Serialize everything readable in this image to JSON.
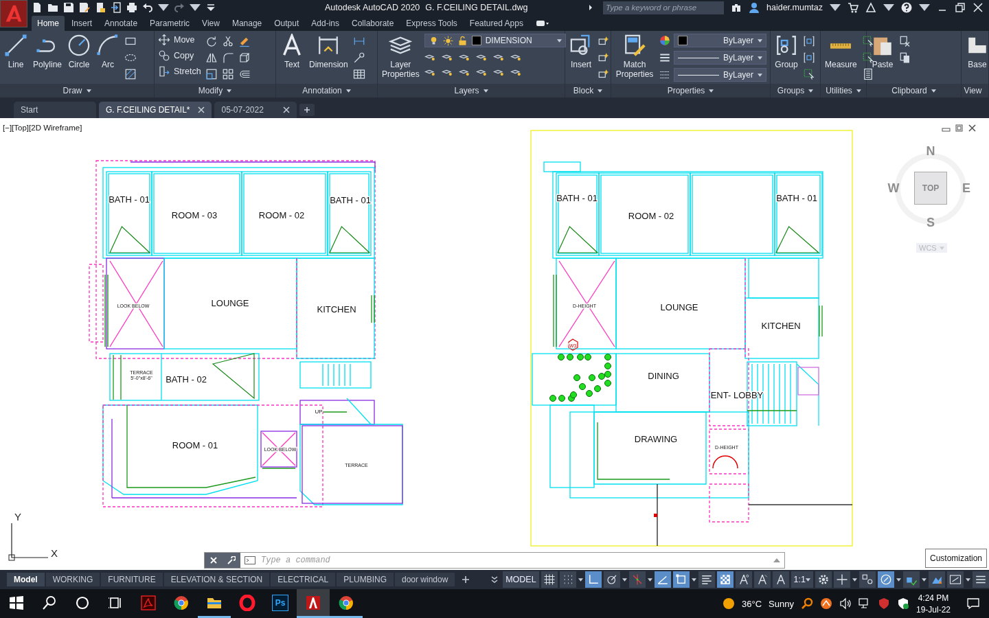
{
  "app": {
    "title": "Autodesk AutoCAD 2020",
    "file": "G. F.CEILING DETAIL.dwg",
    "search_placeholder": "Type a keyword or phrase",
    "user": "haider.mumtaz"
  },
  "ribbon_tabs": [
    {
      "label": "Home",
      "selected": true
    },
    {
      "label": "Insert",
      "selected": false
    },
    {
      "label": "Annotate",
      "selected": false
    },
    {
      "label": "Parametric",
      "selected": false
    },
    {
      "label": "View",
      "selected": false
    },
    {
      "label": "Manage",
      "selected": false
    },
    {
      "label": "Output",
      "selected": false
    },
    {
      "label": "Add-ins",
      "selected": false
    },
    {
      "label": "Collaborate",
      "selected": false
    },
    {
      "label": "Express Tools",
      "selected": false
    },
    {
      "label": "Featured Apps",
      "selected": false
    }
  ],
  "panels": [
    {
      "title": "Draw",
      "tools": [
        "Line",
        "Polyline",
        "Circle",
        "Arc"
      ]
    },
    {
      "title": "Modify",
      "tools": [
        "Move",
        "Copy",
        "Stretch"
      ]
    },
    {
      "title": "Annotation",
      "tools": [
        "Text",
        "Dimension"
      ]
    },
    {
      "title": "Layers",
      "tools": [
        "Layer Properties"
      ],
      "layer": "DIMENSION"
    },
    {
      "title": "Block",
      "tools": [
        "Insert"
      ]
    },
    {
      "title": "Properties",
      "tools": [
        "Match Properties"
      ],
      "combos": [
        "ByLayer",
        "ByLayer",
        "ByLayer"
      ]
    },
    {
      "title": "Groups",
      "tools": [
        "Group"
      ]
    },
    {
      "title": "Utilities",
      "tools": [
        "Measure"
      ]
    },
    {
      "title": "Clipboard",
      "tools": [
        "Paste"
      ]
    },
    {
      "title": "View",
      "tools": [
        "Base"
      ]
    }
  ],
  "doc_tabs": [
    {
      "label": "Start",
      "selected": false
    },
    {
      "label": "G. F.CEILING DETAIL*",
      "selected": true
    },
    {
      "label": "05-07-2022",
      "selected": false
    }
  ],
  "viewport": {
    "label": "[−][Top][2D Wireframe]"
  },
  "viewcube": {
    "north": "N",
    "east": "E",
    "south": "S",
    "west": "W",
    "face": "TOP",
    "ucs": "WCS"
  },
  "ucs": {
    "y_label": "Y",
    "x_label": "X"
  },
  "plans": [
    {
      "rooms": [
        "BATH - 01",
        "ROOM - 03",
        "ROOM - 02",
        "BATH - 01",
        "LOOK BELOW",
        "LOUNGE",
        "KITCHEN",
        "TERRACE",
        "5'-0\"x8'-6\"",
        "BATH - 02",
        "UP",
        "ROOM - 01",
        "LOOK BELOW",
        "TERRACE"
      ]
    },
    {
      "rooms": [
        "BATH - 01",
        "ROOM - 02",
        "BATH - 01",
        "D-HEIGHT",
        "W3",
        "LOUNGE",
        "KITCHEN",
        "DINING",
        "ENT- LOBBY",
        "DRAWING",
        "D-HEIGHT"
      ]
    }
  ],
  "command_line": {
    "placeholder": "Type a command"
  },
  "tooltip": "Customization",
  "layout_tabs": [
    {
      "label": "Model",
      "selected": true
    },
    {
      "label": "WORKING",
      "selected": false
    },
    {
      "label": "FURNITURE",
      "selected": false
    },
    {
      "label": "ELEVATION & SECTION",
      "selected": false
    },
    {
      "label": "ELECTRICAL",
      "selected": false
    },
    {
      "label": "PLUMBING",
      "selected": false
    },
    {
      "label": "door window",
      "selected": false
    }
  ],
  "status": {
    "space": "MODEL",
    "scale": "1:1",
    "toggles": [
      {
        "on": false
      },
      {
        "on": false
      },
      {
        "on": true
      },
      {
        "on": false
      },
      {
        "on": false
      },
      {
        "on": true
      },
      {
        "on": true
      },
      {
        "on": false
      },
      {
        "on": true
      },
      {
        "on": false
      },
      {
        "on": false
      },
      {
        "on": false
      }
    ],
    "toggles_right": [
      {
        "on": false
      },
      {
        "on": false
      },
      {
        "on": false
      },
      {
        "on": true
      },
      {
        "on": false
      },
      {
        "on": false
      },
      {
        "on": false
      },
      {
        "on": false
      }
    ]
  },
  "taskbar": {
    "apps": [
      {
        "running": false,
        "active": false
      },
      {
        "running": false,
        "active": false
      },
      {
        "running": true,
        "active": false
      },
      {
        "running": false,
        "active": false
      },
      {
        "running": false,
        "active": false,
        "label": "Ps"
      },
      {
        "running": true,
        "active": true
      },
      {
        "running": true,
        "active": false
      }
    ],
    "weather": {
      "temp": "36°C",
      "condition": "Sunny"
    },
    "time": "4:24 PM",
    "date": "19-Jul-22"
  }
}
